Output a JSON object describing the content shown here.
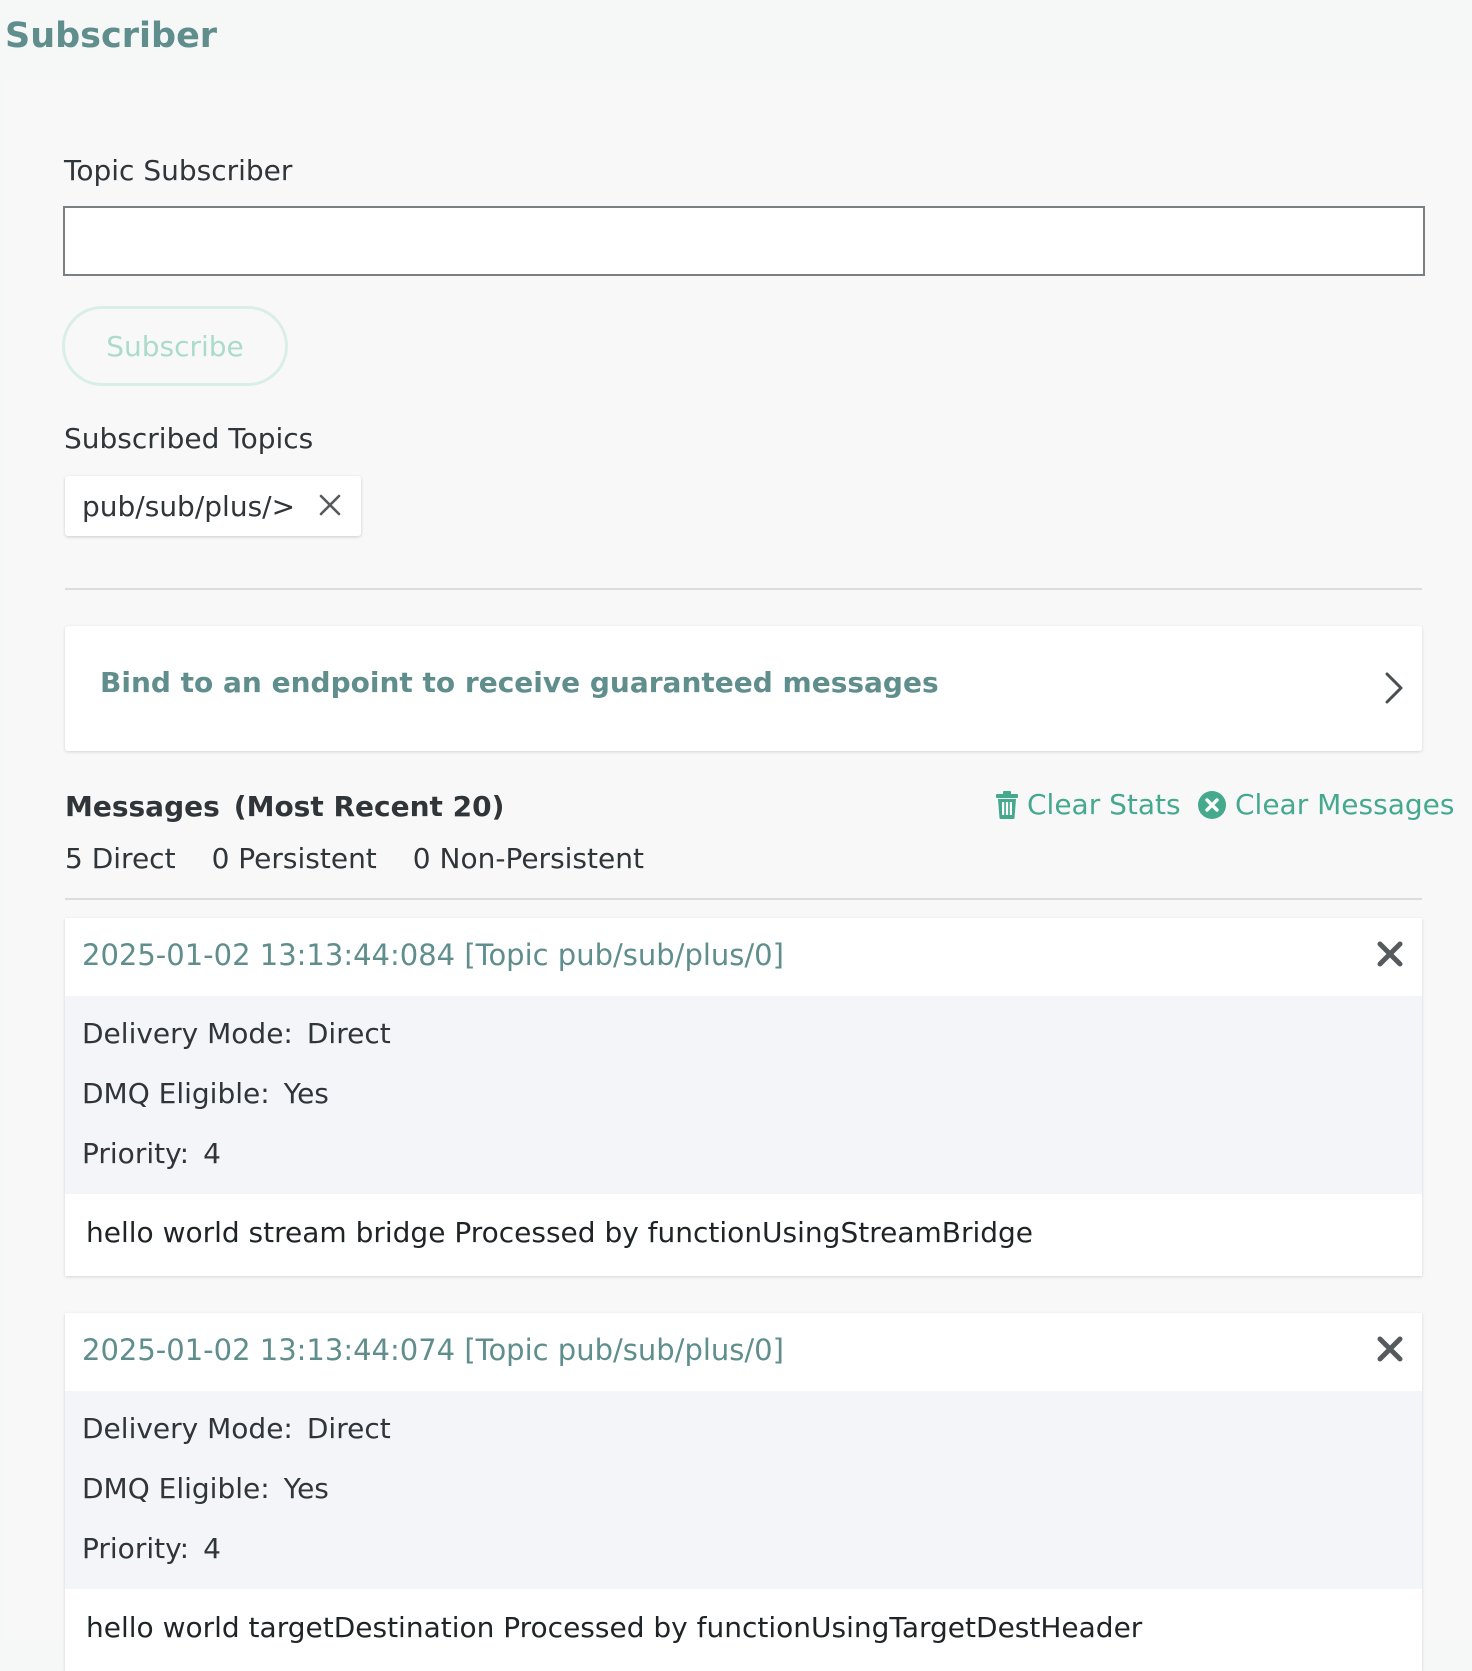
{
  "page": {
    "title": "Subscriber"
  },
  "subscriber": {
    "label": "Topic Subscriber",
    "input_value": "",
    "input_placeholder": "",
    "subscribe_button": "Subscribe"
  },
  "subscribed_topics": {
    "label": "Subscribed Topics",
    "items": [
      {
        "topic": "pub/sub/plus/>",
        "icon": "close-icon"
      }
    ]
  },
  "bind": {
    "text": "Bind to an endpoint to receive guaranteed messages",
    "icon": "chevron-right-icon"
  },
  "messages": {
    "title": "Messages",
    "subtitle": "(Most Recent 20)",
    "clear_stats": {
      "label": "Clear Stats",
      "icon": "trash-icon"
    },
    "clear_messages": {
      "label": "Clear Messages",
      "icon": "close-circle-icon"
    },
    "counts": {
      "direct": "5 Direct",
      "persistent": "0 Persistent",
      "non_persistent": "0 Non-Persistent"
    },
    "items": [
      {
        "header": "2025-01-02 13:13:44:084 [Topic pub/sub/plus/0]",
        "delivery_mode_label": "Delivery Mode:",
        "delivery_mode": "Direct",
        "dmq_label": "DMQ Eligible:",
        "dmq": "Yes",
        "priority_label": "Priority:",
        "priority": "4",
        "body": "hello world stream bridge Processed by functionUsingStreamBridge"
      },
      {
        "header": "2025-01-02 13:13:44:074 [Topic pub/sub/plus/0]",
        "delivery_mode_label": "Delivery Mode:",
        "delivery_mode": "Direct",
        "dmq_label": "DMQ Eligible:",
        "dmq": "Yes",
        "priority_label": "Priority:",
        "priority": "4",
        "body": "hello world targetDestination Processed by functionUsingTargetDestHeader"
      }
    ]
  },
  "colors": {
    "brand_teal": "#5f8e8d",
    "action_green": "#45a98e",
    "button_disabled": "#abdccb"
  }
}
